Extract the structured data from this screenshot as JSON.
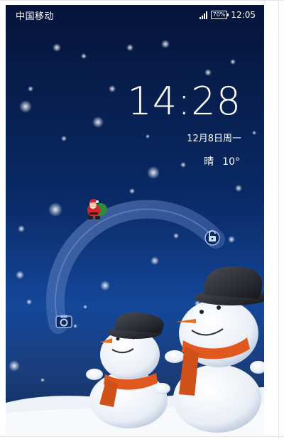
{
  "status_bar": {
    "carrier": "中国移动",
    "battery": "70%",
    "time": "12:05"
  },
  "lockscreen": {
    "clock": "14:28",
    "date": "12月8日周一",
    "weather_condition": "晴",
    "temperature": "10°"
  },
  "unlock_ring": {
    "start_icon": "santa-icon",
    "unlock_icon": "padlock-icon",
    "camera_icon": "camera-icon"
  },
  "wallpaper": {
    "theme": "snowmen-night",
    "colors": {
      "sky_top": "#05143a",
      "sky_bottom": "#14479a",
      "snow": "#f2f5fa",
      "scarf": "#e0581e"
    }
  }
}
